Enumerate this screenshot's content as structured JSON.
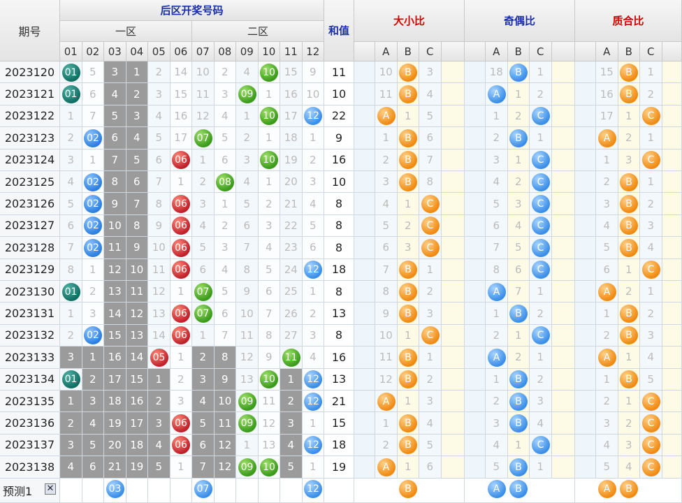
{
  "headers": {
    "period": "期号",
    "back_zone": "后区开奖号码",
    "zone1": "一区",
    "zone2": "二区",
    "sum": "和值",
    "size_ratio": "大小比",
    "odd_even_ratio": "奇偶比",
    "prime_ratio": "质合比",
    "numbers": [
      "01",
      "02",
      "03",
      "04",
      "05",
      "06",
      "07",
      "08",
      "09",
      "10",
      "11",
      "12"
    ],
    "abc": [
      "A",
      "B",
      "C"
    ]
  },
  "rows": [
    {
      "period": "2023120",
      "nums": [
        "01",
        "5",
        "3",
        "1",
        "2",
        "14",
        "10",
        "2",
        "4",
        "10",
        "15",
        "9"
      ],
      "sum": "11",
      "size": [
        "10",
        "B",
        "3"
      ],
      "oe": [
        "18",
        "B",
        "1"
      ],
      "pr": [
        "15",
        "B",
        "1"
      ]
    },
    {
      "period": "2023121",
      "nums": [
        "01",
        "6",
        "4",
        "2",
        "3",
        "15",
        "11",
        "3",
        "09",
        "1",
        "16",
        "10"
      ],
      "sum": "10",
      "size": [
        "11",
        "B",
        "4"
      ],
      "oe": [
        "A",
        "1",
        "2"
      ],
      "pr": [
        "16",
        "B",
        "2"
      ]
    },
    {
      "period": "2023122",
      "nums": [
        "1",
        "7",
        "5",
        "3",
        "4",
        "16",
        "12",
        "4",
        "1",
        "10",
        "17",
        "12"
      ],
      "sum": "22",
      "size": [
        "A",
        "1",
        "5"
      ],
      "oe": [
        "1",
        "2",
        "C"
      ],
      "pr": [
        "17",
        "1",
        "C"
      ]
    },
    {
      "period": "2023123",
      "nums": [
        "2",
        "02",
        "6",
        "4",
        "5",
        "17",
        "07",
        "5",
        "2",
        "1",
        "18",
        "1"
      ],
      "sum": "9",
      "size": [
        "1",
        "B",
        "6"
      ],
      "oe": [
        "2",
        "B",
        "1"
      ],
      "pr": [
        "A",
        "2",
        "1"
      ]
    },
    {
      "period": "2023124",
      "nums": [
        "3",
        "1",
        "7",
        "5",
        "6",
        "06",
        "1",
        "6",
        "3",
        "10",
        "19",
        "2"
      ],
      "sum": "16",
      "size": [
        "2",
        "B",
        "7"
      ],
      "oe": [
        "3",
        "1",
        "C"
      ],
      "pr": [
        "1",
        "3",
        "C"
      ]
    },
    {
      "period": "2023125",
      "nums": [
        "4",
        "02",
        "8",
        "6",
        "7",
        "1",
        "2",
        "08",
        "4",
        "1",
        "20",
        "3"
      ],
      "sum": "10",
      "size": [
        "3",
        "B",
        "8"
      ],
      "oe": [
        "4",
        "2",
        "C"
      ],
      "pr": [
        "2",
        "B",
        "1"
      ]
    },
    {
      "period": "2023126",
      "nums": [
        "5",
        "02",
        "9",
        "7",
        "8",
        "06",
        "3",
        "1",
        "5",
        "2",
        "21",
        "4"
      ],
      "sum": "8",
      "size": [
        "4",
        "1",
        "C"
      ],
      "oe": [
        "5",
        "3",
        "C"
      ],
      "pr": [
        "3",
        "B",
        "2"
      ]
    },
    {
      "period": "2023127",
      "nums": [
        "6",
        "02",
        "10",
        "8",
        "9",
        "06",
        "4",
        "2",
        "6",
        "3",
        "22",
        "5"
      ],
      "sum": "8",
      "size": [
        "5",
        "2",
        "C"
      ],
      "oe": [
        "6",
        "4",
        "C"
      ],
      "pr": [
        "4",
        "B",
        "3"
      ]
    },
    {
      "period": "2023128",
      "nums": [
        "7",
        "02",
        "11",
        "9",
        "10",
        "06",
        "5",
        "3",
        "7",
        "4",
        "23",
        "6"
      ],
      "sum": "8",
      "size": [
        "6",
        "3",
        "C"
      ],
      "oe": [
        "7",
        "5",
        "C"
      ],
      "pr": [
        "5",
        "B",
        "4"
      ]
    },
    {
      "period": "2023129",
      "nums": [
        "8",
        "1",
        "12",
        "10",
        "11",
        "06",
        "6",
        "4",
        "8",
        "5",
        "24",
        "12"
      ],
      "sum": "18",
      "size": [
        "7",
        "B",
        "1"
      ],
      "oe": [
        "8",
        "6",
        "C"
      ],
      "pr": [
        "6",
        "1",
        "C"
      ]
    },
    {
      "period": "2023130",
      "nums": [
        "01",
        "2",
        "13",
        "11",
        "12",
        "1",
        "07",
        "5",
        "9",
        "6",
        "25",
        "1"
      ],
      "sum": "8",
      "size": [
        "8",
        "B",
        "2"
      ],
      "oe": [
        "A",
        "7",
        "1"
      ],
      "pr": [
        "A",
        "2",
        "1"
      ]
    },
    {
      "period": "2023131",
      "nums": [
        "1",
        "3",
        "14",
        "12",
        "13",
        "06",
        "07",
        "6",
        "10",
        "7",
        "26",
        "2"
      ],
      "sum": "13",
      "size": [
        "9",
        "B",
        "3"
      ],
      "oe": [
        "1",
        "B",
        "2"
      ],
      "pr": [
        "1",
        "B",
        "2"
      ]
    },
    {
      "period": "2023132",
      "nums": [
        "2",
        "02",
        "15",
        "13",
        "14",
        "06",
        "1",
        "7",
        "11",
        "8",
        "27",
        "3"
      ],
      "sum": "8",
      "size": [
        "10",
        "1",
        "C"
      ],
      "oe": [
        "2",
        "1",
        "C"
      ],
      "pr": [
        "2",
        "B",
        "3"
      ]
    },
    {
      "period": "2023133",
      "nums": [
        "3",
        "1",
        "16",
        "14",
        "05",
        "1",
        "2",
        "8",
        "12",
        "9",
        "11",
        "4"
      ],
      "sum": "16",
      "size": [
        "11",
        "B",
        "1"
      ],
      "oe": [
        "A",
        "2",
        "1"
      ],
      "pr": [
        "A",
        "1",
        "4"
      ]
    },
    {
      "period": "2023134",
      "nums": [
        "01",
        "2",
        "17",
        "15",
        "1",
        "2",
        "3",
        "9",
        "13",
        "10",
        "1",
        "12"
      ],
      "sum": "13",
      "size": [
        "12",
        "B",
        "2"
      ],
      "oe": [
        "1",
        "B",
        "2"
      ],
      "pr": [
        "1",
        "B",
        "5"
      ]
    },
    {
      "period": "2023135",
      "nums": [
        "1",
        "3",
        "18",
        "16",
        "2",
        "3",
        "4",
        "10",
        "09",
        "11",
        "2",
        "12"
      ],
      "sum": "21",
      "size": [
        "A",
        "1",
        "3"
      ],
      "oe": [
        "2",
        "B",
        "3"
      ],
      "pr": [
        "2",
        "1",
        "C"
      ]
    },
    {
      "period": "2023136",
      "nums": [
        "2",
        "4",
        "19",
        "17",
        "3",
        "06",
        "5",
        "11",
        "09",
        "12",
        "3",
        "1"
      ],
      "sum": "15",
      "size": [
        "1",
        "B",
        "4"
      ],
      "oe": [
        "3",
        "B",
        "4"
      ],
      "pr": [
        "3",
        "2",
        "C"
      ]
    },
    {
      "period": "2023137",
      "nums": [
        "3",
        "5",
        "20",
        "18",
        "4",
        "06",
        "6",
        "12",
        "1",
        "13",
        "4",
        "12"
      ],
      "sum": "18",
      "size": [
        "2",
        "B",
        "5"
      ],
      "oe": [
        "4",
        "1",
        "C"
      ],
      "pr": [
        "4",
        "3",
        "C"
      ]
    },
    {
      "period": "2023138",
      "nums": [
        "4",
        "6",
        "21",
        "19",
        "5",
        "1",
        "7",
        "12",
        "09",
        "10",
        "5",
        "1"
      ],
      "sum": "19",
      "size": [
        "A",
        "1",
        "6"
      ],
      "oe": [
        "5",
        "B",
        "1"
      ],
      "pr": [
        "5",
        "4",
        "C"
      ]
    }
  ],
  "prediction": {
    "label": "预测1",
    "close": "✕",
    "balls": [
      "03",
      "07",
      "12"
    ],
    "size": [
      "B"
    ],
    "oe": [
      "A",
      "B"
    ],
    "pr": [
      "A",
      "B"
    ]
  },
  "colors": {
    "teal": "#0f6e62",
    "blue": "#2b7fe0",
    "green": "#3a9a1a",
    "red": "#c0202a",
    "orange": "#f08a10",
    "gray": "#9b9b9b"
  }
}
